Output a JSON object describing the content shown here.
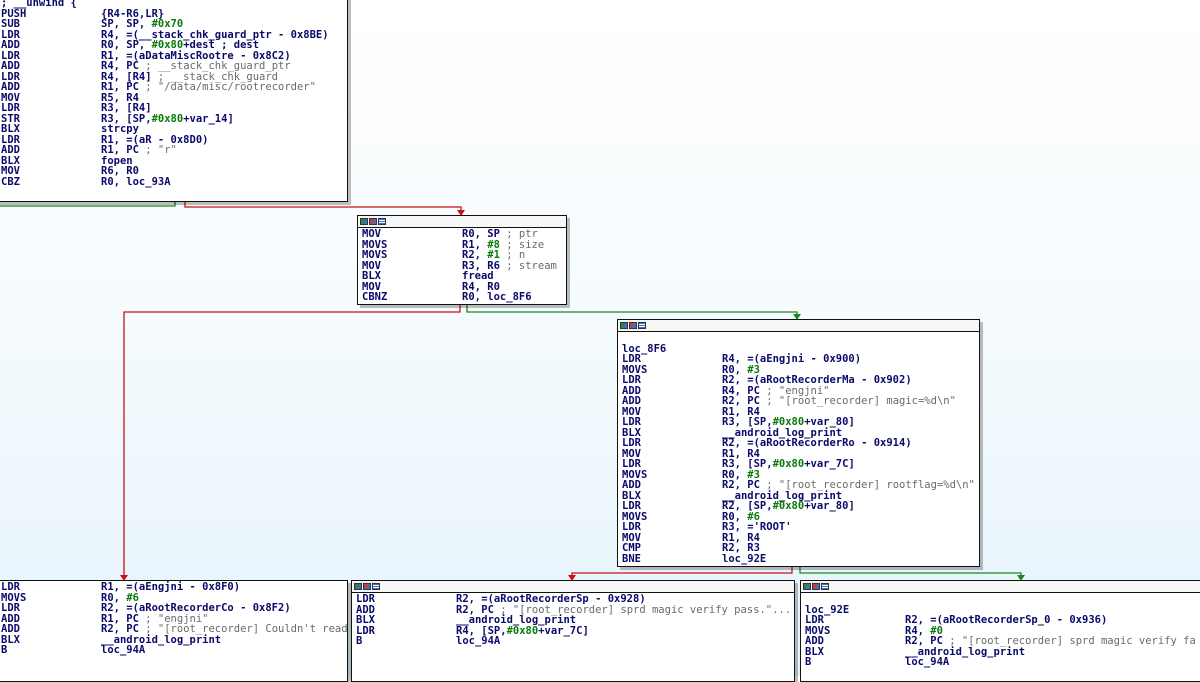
{
  "colors": {
    "edge_true": "#1a8a1a",
    "edge_false": "#cc1111",
    "edge_uncond": "#1a3ad0",
    "mnemonic": "#0a0a6a",
    "comment": "#6a6a6a",
    "immediate": "#0a7a0a"
  },
  "nodes": [
    {
      "id": "entry",
      "has_header": false,
      "lines": [
        {
          "label": "; __unwind {"
        },
        {
          "mn": "PUSH",
          "op": "{R4-R6,LR}"
        },
        {
          "mn": "SUB",
          "op": "SP, SP, #0x70"
        },
        {
          "mn": "LDR",
          "op": "R4, =(__stack_chk_guard_ptr - 0x8BE)"
        },
        {
          "mn": "ADD",
          "op": "R0, SP, #0x80+dest ; dest"
        },
        {
          "mn": "LDR",
          "op": "R1, =(aDataMiscRootre - 0x8C2)"
        },
        {
          "mn": "ADD",
          "op": "R4, PC",
          "cm": " ; __stack_chk_guard_ptr"
        },
        {
          "mn": "LDR",
          "op": "R4, [R4]",
          "cm": " ; __stack_chk_guard"
        },
        {
          "mn": "ADD",
          "op": "R1, PC",
          "cm": " ; \"/data/misc/rootrecorder\""
        },
        {
          "mn": "MOV",
          "op": "R5, R4"
        },
        {
          "mn": "LDR",
          "op": "R3, [R4]"
        },
        {
          "mn": "STR",
          "op": "R3, [SP,#0x80+var_14]"
        },
        {
          "mn": "BLX",
          "op": "strcpy"
        },
        {
          "mn": "LDR",
          "op": "R1, =(aR - 0x8D0)"
        },
        {
          "mn": "ADD",
          "op": "R1, PC",
          "cm": " ; \"r\""
        },
        {
          "mn": "BLX",
          "op": "fopen"
        },
        {
          "mn": "MOV",
          "op": "R6, R0"
        },
        {
          "mn": "CBZ",
          "op": "R0, loc_93A"
        }
      ]
    },
    {
      "id": "fread_block",
      "has_header": true,
      "lines": [
        {
          "mn": "MOV",
          "op": "R0, SP",
          "cm": " ; ptr"
        },
        {
          "mn": "MOVS",
          "op": "R1, #8",
          "cm": " ; size"
        },
        {
          "mn": "MOVS",
          "op": "R2, #1",
          "cm": " ; n"
        },
        {
          "mn": "MOV",
          "op": "R3, R6",
          "cm": " ; stream"
        },
        {
          "mn": "BLX",
          "op": "fread"
        },
        {
          "mn": "MOV",
          "op": "R4, R0"
        },
        {
          "mn": "CBNZ",
          "op": "R0, loc_8F6"
        }
      ]
    },
    {
      "id": "loc_8F6",
      "has_header": true,
      "lines": [
        {
          "label": ""
        },
        {
          "label": "loc_8F6"
        },
        {
          "mn": "LDR",
          "op": "R4, =(aEngjni - 0x900)"
        },
        {
          "mn": "MOVS",
          "op": "R0, #3"
        },
        {
          "mn": "LDR",
          "op": "R2, =(aRootRecorderMa - 0x902)"
        },
        {
          "mn": "ADD",
          "op": "R4, PC",
          "cm": " ; \"engjni\""
        },
        {
          "mn": "ADD",
          "op": "R2, PC",
          "cm": " ; \"[root_recorder] magic=%d\\n\""
        },
        {
          "mn": "MOV",
          "op": "R1, R4"
        },
        {
          "mn": "LDR",
          "op": "R3, [SP,#0x80+var_80]"
        },
        {
          "mn": "BLX",
          "op": "__android_log_print"
        },
        {
          "mn": "LDR",
          "op": "R2, =(aRootRecorderRo - 0x914)"
        },
        {
          "mn": "MOV",
          "op": "R1, R4"
        },
        {
          "mn": "LDR",
          "op": "R3, [SP,#0x80+var_7C]"
        },
        {
          "mn": "MOVS",
          "op": "R0, #3"
        },
        {
          "mn": "ADD",
          "op": "R2, PC",
          "cm": " ; \"[root_recorder] rootflag=%d\\n\""
        },
        {
          "mn": "BLX",
          "op": "__android_log_print"
        },
        {
          "mn": "LDR",
          "op": "R2, [SP,#0x80+var_80]"
        },
        {
          "mn": "MOVS",
          "op": "R0, #6"
        },
        {
          "mn": "LDR",
          "op": "R3, ='ROOT'"
        },
        {
          "mn": "MOV",
          "op": "R1, R4"
        },
        {
          "mn": "CMP",
          "op": "R2, R3"
        },
        {
          "mn": "BNE",
          "op": "loc_92E"
        }
      ]
    },
    {
      "id": "magic_fail",
      "has_header": false,
      "lines": [
        {
          "mn": "LDR",
          "op": "R1, =(aEngjni - 0x8F0)"
        },
        {
          "mn": "MOVS",
          "op": "R0, #6"
        },
        {
          "mn": "LDR",
          "op": "R2, =(aRootRecorderCo - 0x8F2)"
        },
        {
          "mn": "ADD",
          "op": "R1, PC",
          "cm": " ; \"engjni\""
        },
        {
          "mn": "ADD",
          "op": "R2, PC",
          "cm": " ; \"[root_recorder] Couldn't read magic num\"..."
        },
        {
          "mn": "BLX",
          "op": "__android_log_print"
        },
        {
          "mn": "B",
          "op": "loc_94A"
        }
      ]
    },
    {
      "id": "verify_pass",
      "has_header": true,
      "lines": [
        {
          "mn": "LDR",
          "op": "R2, =(aRootRecorderSp - 0x928)"
        },
        {
          "mn": "ADD",
          "op": "R2, PC",
          "cm": " ; \"[root_recorder] sprd magic verify pass.\"..."
        },
        {
          "mn": "BLX",
          "op": "__android_log_print"
        },
        {
          "mn": "LDR",
          "op": "R4, [SP,#0x80+var_7C]"
        },
        {
          "mn": "B",
          "op": "loc_94A"
        }
      ]
    },
    {
      "id": "loc_92E",
      "has_header": true,
      "lines": [
        {
          "label": ""
        },
        {
          "label": "loc_92E"
        },
        {
          "mn": "LDR",
          "op": "R2, =(aRootRecorderSp_0 - 0x936)"
        },
        {
          "mn": "MOVS",
          "op": "R4, #0"
        },
        {
          "mn": "ADD",
          "op": "R2, PC",
          "cm": " ; \"[root_recorder] sprd magic verify fa"
        },
        {
          "mn": "BLX",
          "op": "__android_log_print"
        },
        {
          "mn": "B",
          "op": "loc_94A"
        }
      ]
    }
  ]
}
